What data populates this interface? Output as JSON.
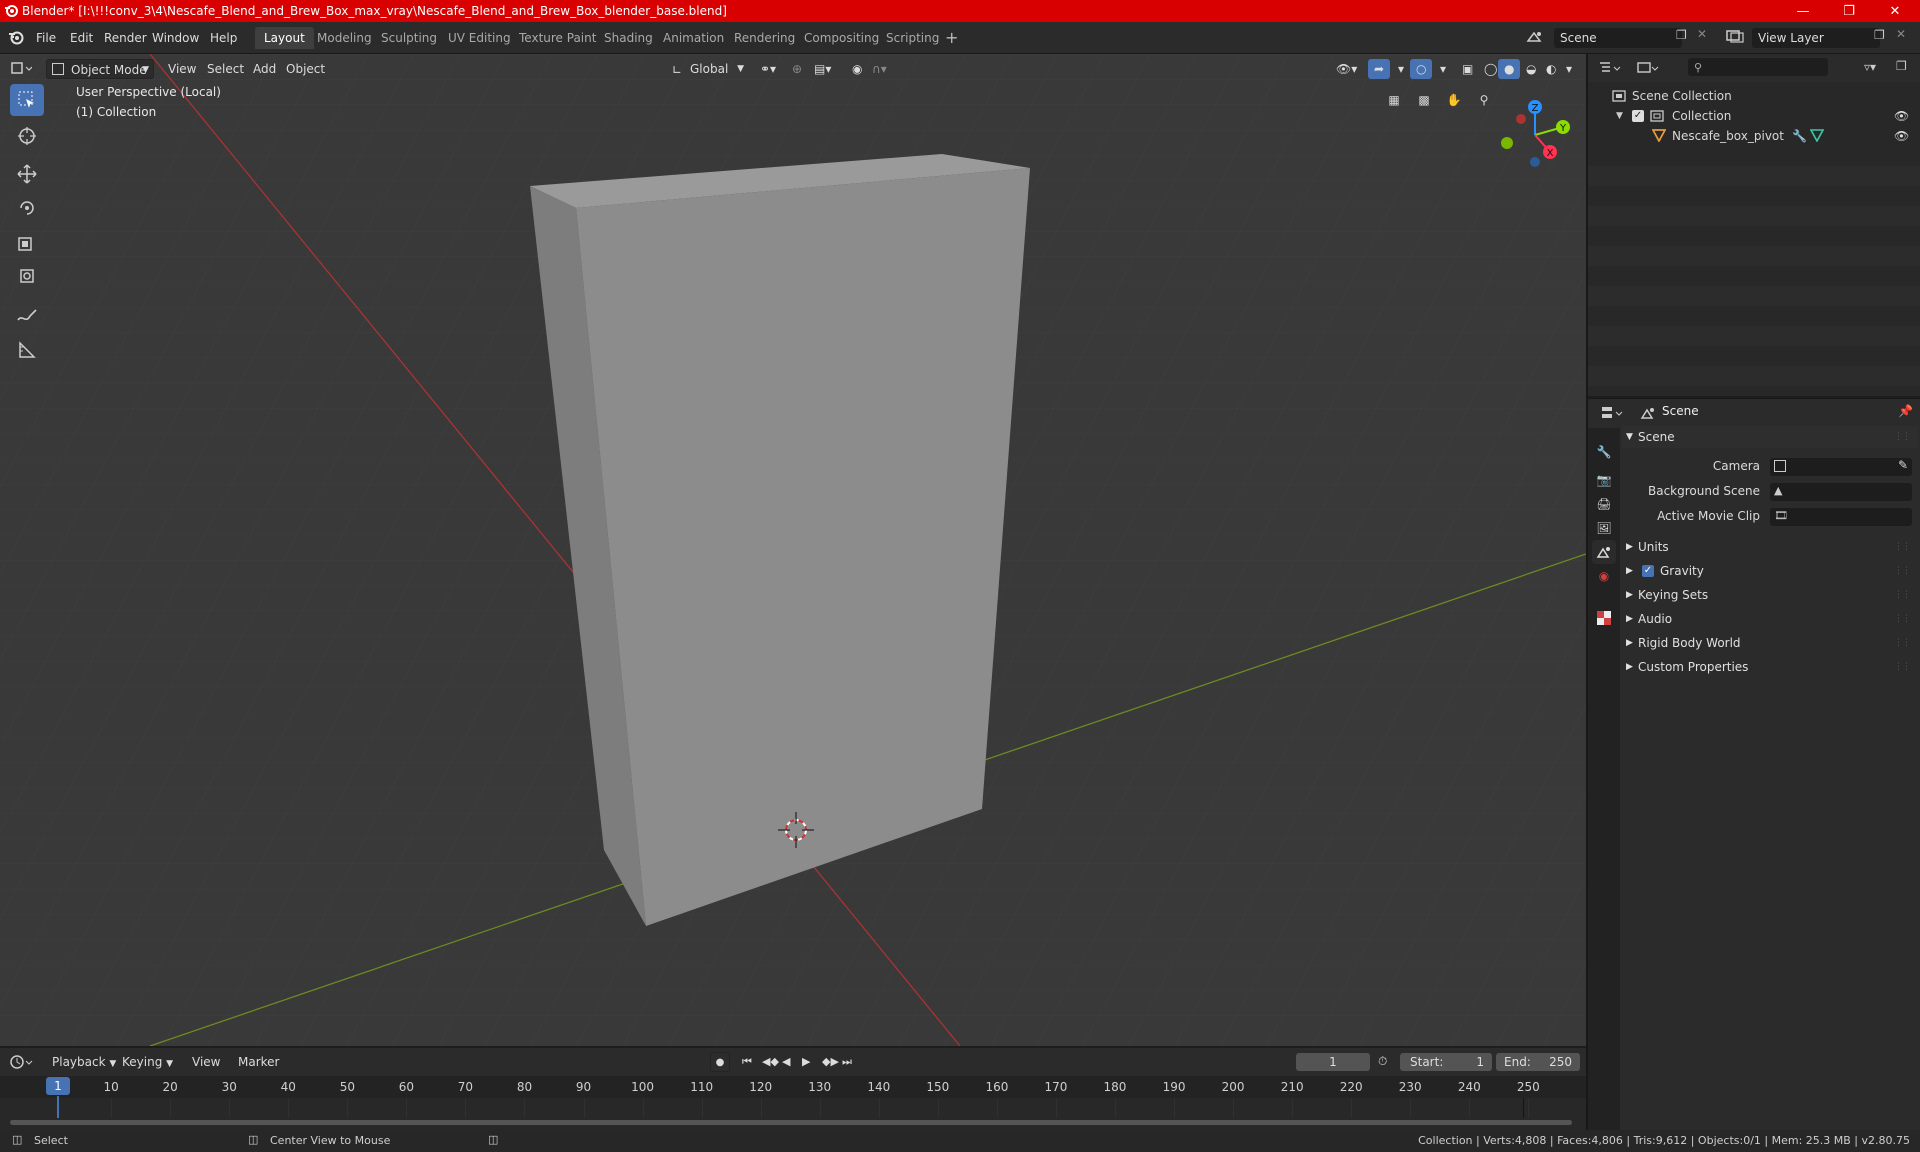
{
  "window": {
    "title": "Blender* [I:\\!!!conv_3\\4\\Nescafe_Blend_and_Brew_Box_max_vray\\Nescafe_Blend_and_Brew_Box_blender_base.blend]"
  },
  "menu": [
    "File",
    "Edit",
    "Render",
    "Window",
    "Help"
  ],
  "workspaces": [
    "Layout",
    "Modeling",
    "Sculpting",
    "UV Editing",
    "Texture Paint",
    "Shading",
    "Animation",
    "Rendering",
    "Compositing",
    "Scripting"
  ],
  "active_workspace": "Layout",
  "scene_field": "Scene",
  "view_layer_field": "View Layer",
  "viewport": {
    "mode": "Object Mode",
    "menus": [
      "View",
      "Select",
      "Add",
      "Object"
    ],
    "transform_orientation": "Global",
    "overlay_line1": "User Perspective (Local)",
    "overlay_line2": "(1) Collection",
    "gizmo_axes": [
      "Z",
      "Y",
      "X"
    ]
  },
  "outliner": {
    "root": "Scene Collection",
    "collection": "Collection",
    "object": "Nescafe_box_pivot"
  },
  "properties": {
    "context": "Scene",
    "panel_title": "Scene",
    "camera_label": "Camera",
    "background_scene_label": "Background Scene",
    "active_movie_clip_label": "Active Movie Clip",
    "sections": [
      "Units",
      "Gravity",
      "Keying Sets",
      "Audio",
      "Rigid Body World",
      "Custom Properties"
    ]
  },
  "timeline": {
    "menus": [
      "Playback",
      "Keying",
      "View",
      "Marker"
    ],
    "current_frame": "1",
    "start_label": "Start:",
    "start": "1",
    "end_label": "End:",
    "end": "250",
    "ticks": [
      "1",
      "10",
      "20",
      "30",
      "40",
      "50",
      "60",
      "70",
      "80",
      "90",
      "100",
      "110",
      "120",
      "130",
      "140",
      "150",
      "160",
      "170",
      "180",
      "190",
      "200",
      "210",
      "220",
      "230",
      "240",
      "250"
    ]
  },
  "status": {
    "left_action": "Select",
    "middle_action": "Center View to Mouse",
    "stats": "Collection | Verts:4,808 | Faces:4,806 | Tris:9,612 | Objects:0/1 | Mem: 25.3 MB | v2.80.75"
  },
  "colors": {
    "title_bar": "#d80000",
    "accent": "#4772b3",
    "x_axis": "#ff3352",
    "y_axis": "#8bdc00",
    "z_axis": "#2890ff"
  }
}
